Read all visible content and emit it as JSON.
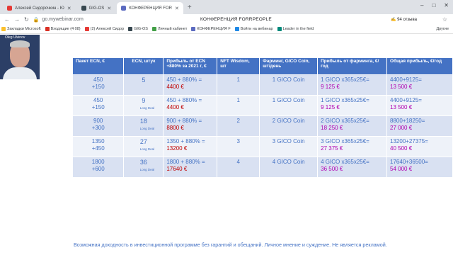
{
  "browser": {
    "tabs": [
      {
        "label": "Алексей Сидорочкин - Ю",
        "icon_color": "#e53935",
        "active": false
      },
      {
        "label": "GIG-OS",
        "icon_color": "#37474f",
        "active": false
      },
      {
        "label": "КОНФЕРЕНЦИЯ FOR",
        "icon_color": "#5c6bc0",
        "active": true
      }
    ],
    "new_tab_symbol": "+",
    "window_controls": [
      "–",
      "□",
      "✕"
    ],
    "url": "go.mywebinar.com",
    "page_title": "КОНФЕРЕНЦИЯ FORRPEOPLE",
    "reviews_badge": "✍ 94 отзыва",
    "bookmarks": [
      {
        "label": "Закладки Microsoft",
        "icon_color": "#fbc02d"
      },
      {
        "label": "Входящие (4 08)",
        "icon_color": "#d93025"
      },
      {
        "label": "(2) Алексей Сидор",
        "icon_color": "#e53935"
      },
      {
        "label": "GIG-OS",
        "icon_color": "#37474f"
      },
      {
        "label": "Личный кабинет",
        "icon_color": "#43a047"
      },
      {
        "label": "КОНФЕРЕНЦИЯ F",
        "icon_color": "#5c6bc0"
      },
      {
        "label": "Войти на вебинар",
        "icon_color": "#1e88e5"
      },
      {
        "label": "Leader in the field",
        "icon_color": "#00897b"
      }
    ],
    "other_bookmarks": "Другие"
  },
  "video": {
    "presenter_name": "Oleg Ulvinov"
  },
  "table": {
    "headers": [
      "Пакет ECN, €",
      "ECN, штук",
      "Прибыль от ECN +880% за 2021 г, €",
      "NFT Wisdom, шт",
      "Фарминг, GICO Coin, шт/день",
      "Прибыль от фарминга, €/год",
      "Общая прибыль, €/год"
    ],
    "rows": [
      {
        "pkg": [
          "450",
          "+150"
        ],
        "ecn": "5",
        "deal": "",
        "ecn_profit": [
          "450 + 880% =",
          "4400 €"
        ],
        "nft": "1",
        "farming": "1 GICO Coin",
        "farm_profit": [
          "1 GICO x365x25€=",
          "9 125 €"
        ],
        "total": [
          "4400+9125=",
          "13 500 €"
        ]
      },
      {
        "pkg": [
          "450",
          "+150"
        ],
        "ecn": "9",
        "deal": "Long Deal",
        "ecn_profit": [
          "450 + 880% =",
          "4400 €"
        ],
        "nft": "1",
        "farming": "1 GICO Coin",
        "farm_profit": [
          "1 GICO x365x25€=",
          "9 125 €"
        ],
        "total": [
          "4400+9125=",
          "13 500 €"
        ]
      },
      {
        "pkg": [
          "900",
          "+300"
        ],
        "ecn": "18",
        "deal": "Long Deal",
        "ecn_profit": [
          "900 + 880% =",
          "8800 €"
        ],
        "nft": "2",
        "farming": "2 GICO Coin",
        "farm_profit": [
          "2 GICO x365x25€=",
          "18 250 €"
        ],
        "total": [
          "8800+18250=",
          "27 000 €"
        ]
      },
      {
        "pkg": [
          "1350",
          "+450"
        ],
        "ecn": "27",
        "deal": "Long Deal",
        "ecn_profit": [
          "1350 + 880% =",
          "13200 €"
        ],
        "nft": "3",
        "farming": "3 GICO Coin",
        "farm_profit": [
          "3 GICO x365x25€=",
          "27 375 €"
        ],
        "total": [
          "13200+27375=",
          "40 500 €"
        ]
      },
      {
        "pkg": [
          "1800",
          "+600"
        ],
        "ecn": "36",
        "deal": "Long Deal",
        "ecn_profit": [
          "1800 + 880% =",
          "17640 €"
        ],
        "nft": "4",
        "farming": "4 GICO Coin",
        "farm_profit": [
          "4 GICO x365x25€=",
          "36 500 €"
        ],
        "total": [
          "17640+36500=",
          "54 000 €"
        ]
      }
    ]
  },
  "disclaimer": "Возможная доходность в инвестиционной программе без гарантий и обещаний. Личное мнение и суждение. Не является рекламой.",
  "colors": {
    "header_bg": "#4472c4",
    "row_odd": "#d9e1f2",
    "row_even": "#eef2f9",
    "text_blue": "#4472c4",
    "text_red": "#c00000",
    "text_pink": "#b000b0"
  }
}
